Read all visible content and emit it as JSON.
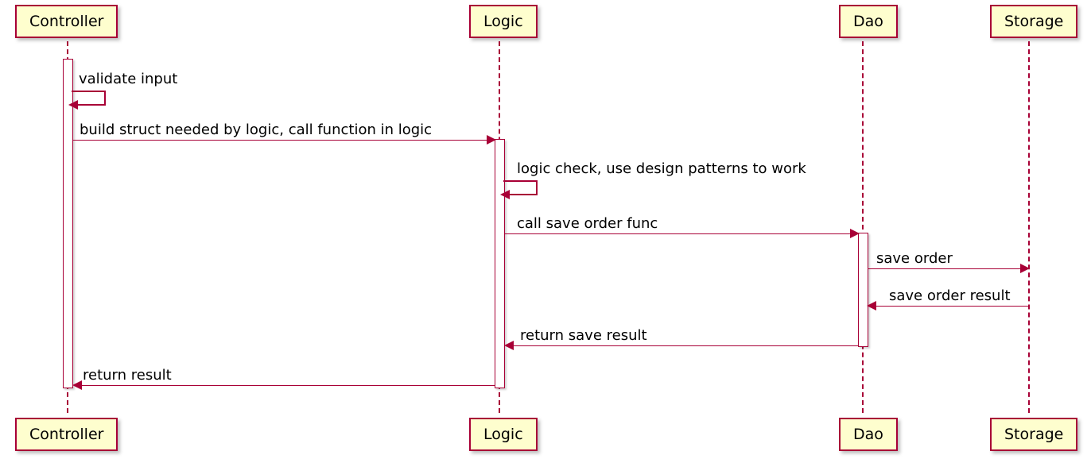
{
  "participants": {
    "controller": "Controller",
    "logic": "Logic",
    "dao": "Dao",
    "storage": "Storage"
  },
  "messages": {
    "validate_input": "validate input",
    "build_struct": "build struct needed by logic, call function in logic",
    "logic_check": "logic check, use design patterns to work",
    "call_save_order": "call save order func",
    "save_order": "save order",
    "save_order_result": "save order result",
    "return_save_result": "return save result",
    "return_result": "return result"
  }
}
